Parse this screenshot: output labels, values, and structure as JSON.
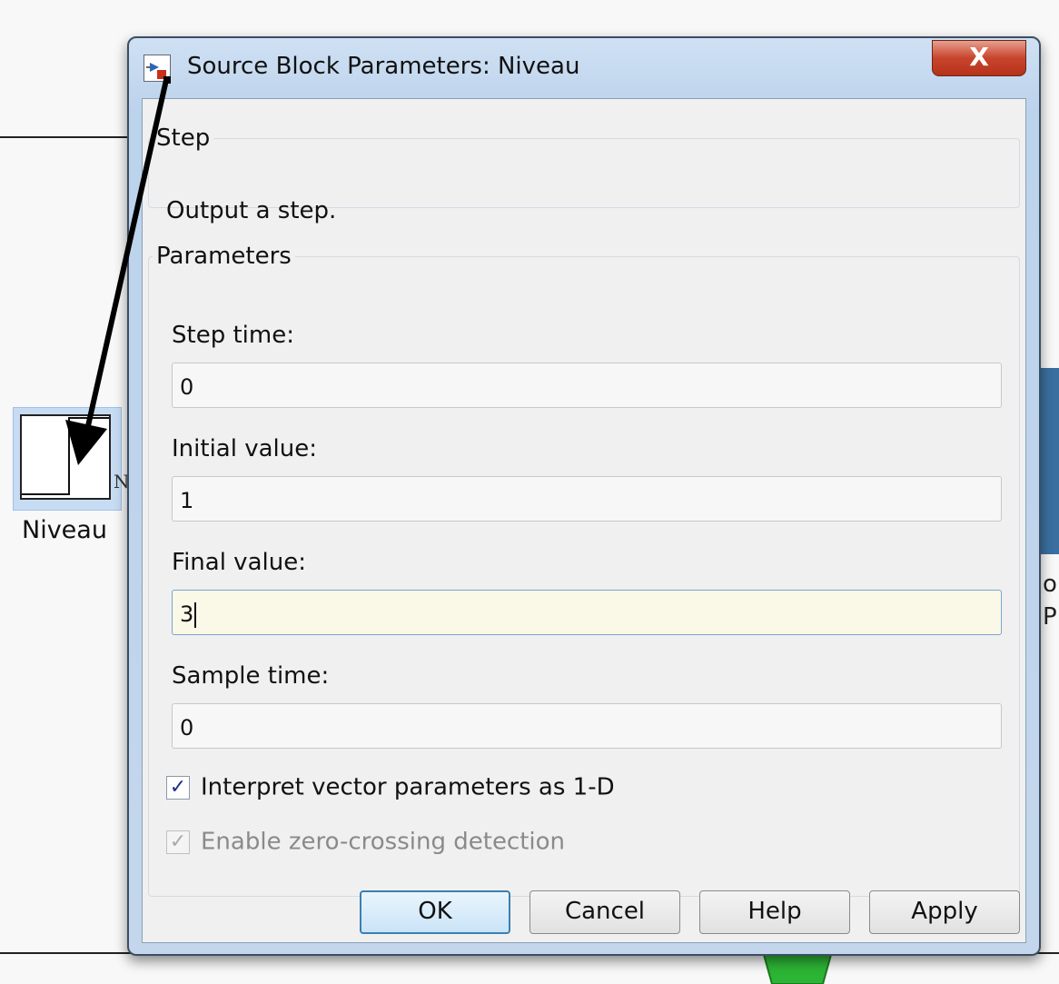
{
  "background": {
    "block_name": "Niveau",
    "block_port_label": "N",
    "right_partial_text": [
      "on",
      "P"
    ]
  },
  "dialog": {
    "title": "Source Block Parameters: Niveau",
    "close_label": "X",
    "step_group": {
      "legend": "Step",
      "description": "Output a step."
    },
    "params_group": {
      "legend": "Parameters",
      "fields": [
        {
          "label": "Step time:",
          "value": "0"
        },
        {
          "label": "Initial value:",
          "value": "1"
        },
        {
          "label": "Final value:",
          "value": "3",
          "focused": true
        },
        {
          "label": "Sample time:",
          "value": "0"
        }
      ],
      "checkboxes": [
        {
          "label": "Interpret vector parameters as 1-D",
          "checked": true,
          "enabled": true
        },
        {
          "label": "Enable zero-crossing detection",
          "checked": true,
          "enabled": false
        }
      ]
    },
    "buttons": {
      "ok": "OK",
      "cancel": "Cancel",
      "help": "Help",
      "apply": "Apply"
    }
  },
  "colors": {
    "accent": "#3c7fb1",
    "close_button": "#c9442c",
    "focused_field": "#faf8e6",
    "annotation_arrow": "#000000"
  }
}
